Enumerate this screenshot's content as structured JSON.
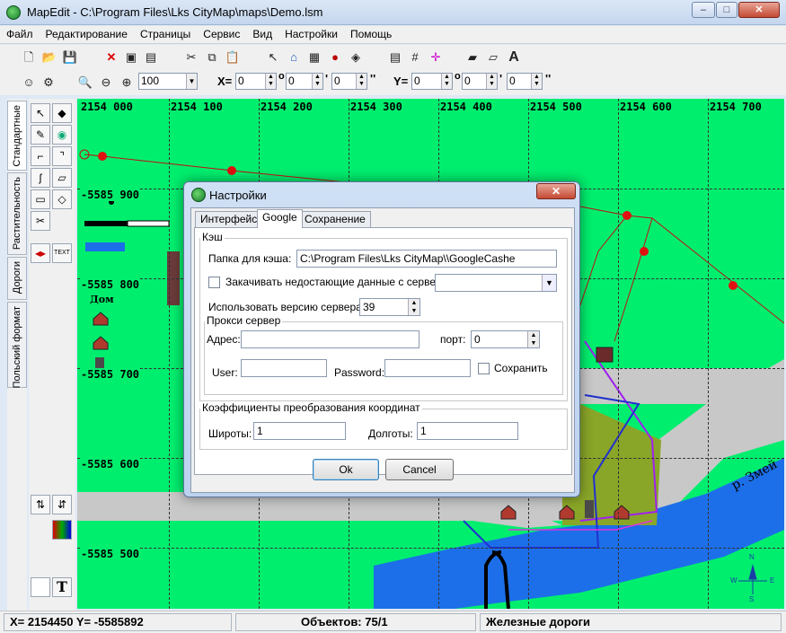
{
  "window": {
    "title": "MapEdit - C:\\Program Files\\Lks CityMap\\maps\\Demo.lsm",
    "minimize": "–",
    "maximize": "□",
    "close": "✕"
  },
  "menu": [
    "Файл",
    "Редактирование",
    "Страницы",
    "Сервис",
    "Вид",
    "Настройки",
    "Помощь"
  ],
  "toolbar": {
    "zoom_value": "100",
    "x_label": "X=",
    "y_label": "Y=",
    "x_deg": "0",
    "x_min": "0",
    "x_sec": "0",
    "y_deg": "0",
    "y_min": "0",
    "y_sec": "0",
    "deg_mark": "o",
    "min_mark": "'",
    "sec_mark": "''"
  },
  "left_tabs": [
    "Стандартные",
    "Растительность",
    "Дороги",
    "Польский формат"
  ],
  "tool_text_label": "TEXT",
  "tool_T_label": "T",
  "map": {
    "x_labels": [
      "2154 000",
      "2154 100",
      "2154 200",
      "2154 300",
      "2154 400",
      "2154 500",
      "2154 600",
      "2154 700"
    ],
    "y_labels": [
      "-5585 900",
      "-5585 800",
      "-5585 700",
      "-5585 600",
      "-5585 500"
    ],
    "house_label": "Дом",
    "river_label": "р. Змей",
    "compass": {
      "n": "N",
      "s": "S",
      "e": "E",
      "w": "W"
    }
  },
  "status": {
    "coords": "X= 2154450   Y= -5585892",
    "objects": "Объектов: 75/1",
    "layer": "Железные дороги"
  },
  "dialog": {
    "title": "Настройки",
    "close": "✕",
    "tabs": [
      "Интерфейс",
      "Google",
      "Сохранение"
    ],
    "cache_group": "Кэш",
    "cache_folder_label": "Папка для кэша:",
    "cache_folder_value": "C:\\Program Files\\Lks CityMap\\\\GoogleCashe",
    "download_missing_label": "Закачивать недостающие данные с сервера",
    "download_missing_checked": false,
    "server_version_label": "Использовать версию сервера:",
    "server_version_value": "39",
    "proxy_group": "Прокси сервер",
    "address_label": "Адрес:",
    "address_value": "",
    "port_label": "порт:",
    "port_value": "0",
    "user_label": "User:",
    "user_value": "",
    "password_label": "Password:",
    "password_value": "",
    "save_label": "Сохранить",
    "save_checked": false,
    "coef_group": "Коэффициенты преобразования координат",
    "lat_label": "Широты:",
    "lat_value": "1",
    "lon_label": "Долготы:",
    "lon_value": "1",
    "ok_label": "Ok",
    "cancel_label": "Cancel"
  },
  "colors": {
    "map_bg": "#00ee6e",
    "road_gray": "#c8c8c8",
    "river_blue": "#1c6fe8",
    "park_olive": "#8aa628",
    "route_red": "#e01010"
  }
}
